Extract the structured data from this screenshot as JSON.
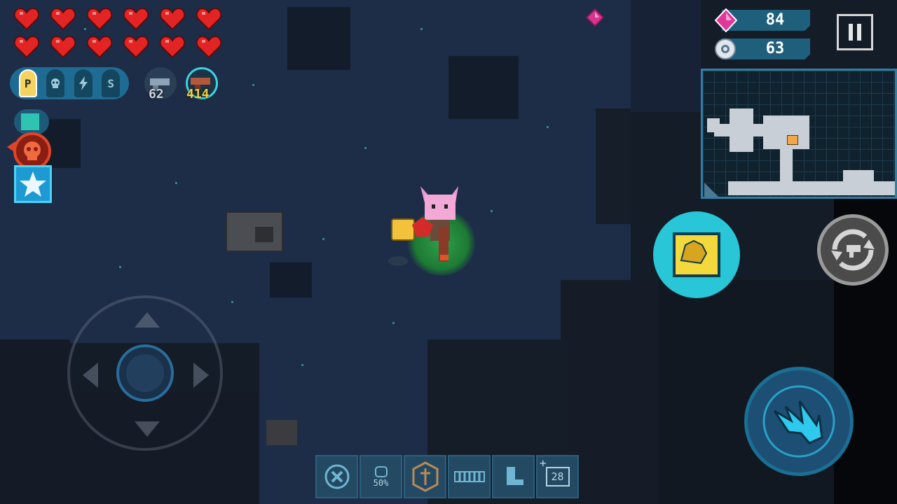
{
  "hud": {
    "hearts": {
      "full": 12,
      "total": 12,
      "color": "#e32424"
    },
    "buffs": [
      {
        "label": "P",
        "active": true
      },
      {
        "label": "",
        "icon": "skull-icon",
        "active": false
      },
      {
        "label": "",
        "icon": "lightning-icon",
        "active": false
      },
      {
        "label": "S",
        "active": false
      }
    ],
    "weapons": [
      {
        "icon": "secondary-weapon-icon",
        "ammo": "62",
        "ammo_color": "#c9d3dc"
      },
      {
        "icon": "primary-weapon-icon",
        "ammo": "414",
        "ammo_color": "#f2d23c"
      }
    ],
    "gems": {
      "icon": "pink-gem-icon",
      "value": "84",
      "color": "#e0389a"
    },
    "energy": {
      "icon": "energy-core-icon",
      "value": "63"
    },
    "pause": {
      "icon": "pause-icon"
    },
    "minimap": {
      "label": "minimap"
    },
    "skill_button": {
      "icon": "lion-skill-icon",
      "color": "#28c6d6"
    },
    "swap_button": {
      "icon": "swap-weapon-icon"
    },
    "attack_button": {
      "icon": "claw-attack-icon"
    },
    "joystick": {
      "icon": "joystick-icon"
    },
    "status_effects": [
      {
        "icon": "character-status-icon"
      },
      {
        "icon": "red-skull-icon"
      },
      {
        "icon": "star-buff-icon"
      }
    ],
    "item_bar": [
      {
        "icon": "cross-circle-icon",
        "label": ""
      },
      {
        "icon": "half-potion-icon",
        "label": "50%"
      },
      {
        "icon": "sword-shield-icon",
        "label": ""
      },
      {
        "icon": "chain-fence-icon",
        "label": ""
      },
      {
        "icon": "boot-icon",
        "label": ""
      },
      {
        "icon": "counter-icon",
        "label": "28"
      }
    ]
  }
}
